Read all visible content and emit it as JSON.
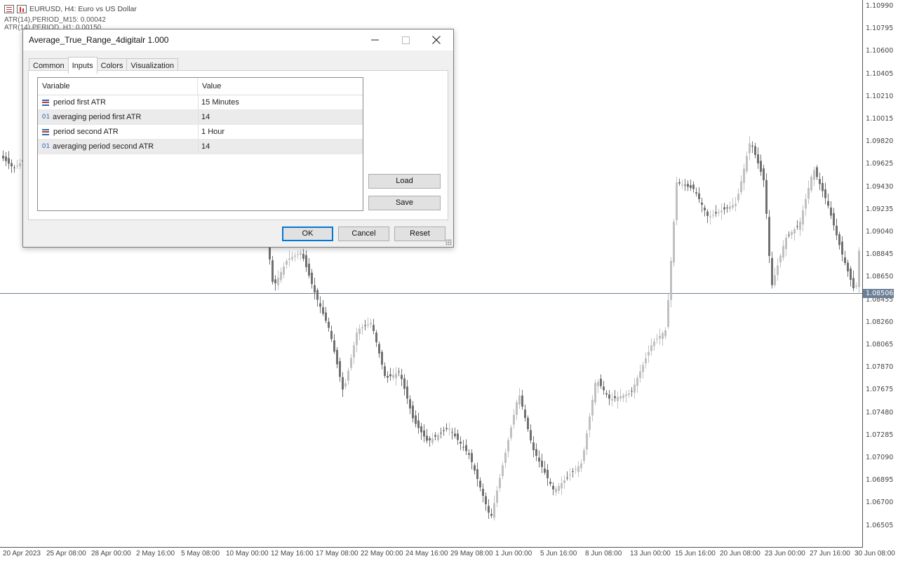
{
  "chart": {
    "symbol_title": "EURUSD, H4:  Euro vs US Dollar",
    "indicator_lines": [
      "ATR(14),PERIOD_M15: 0.00042",
      "ATR(14),PERIOD_H1: 0.00150"
    ],
    "price_labels": [
      "1.10990",
      "1.10795",
      "1.10600",
      "1.10405",
      "1.10210",
      "1.10015",
      "1.09820",
      "1.09625",
      "1.09430",
      "1.09235",
      "1.09040",
      "1.08845",
      "1.08650",
      "1.08455",
      "1.08260",
      "1.08065",
      "1.07870",
      "1.07675",
      "1.07480",
      "1.07285",
      "1.07090",
      "1.06895",
      "1.06700",
      "1.06505"
    ],
    "current_price": "1.08506",
    "date_labels": [
      "20 Apr 2023",
      "25 Apr 08:00",
      "28 Apr 00:00",
      "2 May 16:00",
      "5 May 08:00",
      "10 May 00:00",
      "12 May 16:00",
      "17 May 08:00",
      "22 May 00:00",
      "24 May 16:00",
      "29 May 08:00",
      "1 Jun 00:00",
      "5 Jun 16:00",
      "8 Jun 08:00",
      "13 Jun 00:00",
      "15 Jun 16:00",
      "20 Jun 08:00",
      "23 Jun 00:00",
      "27 Jun 16:00",
      "30 Jun 08:00"
    ],
    "colors": {
      "bull": "#c0c0c0",
      "bear": "#707070",
      "price_line": "#6b7f96"
    }
  },
  "dialog": {
    "title": "Average_True_Range_4digitalr 1.000",
    "window_controls": {
      "minimize": "—",
      "maximize": "☐",
      "close": "✕"
    },
    "tabs": [
      {
        "label": "Common",
        "active": false
      },
      {
        "label": "Inputs",
        "active": true
      },
      {
        "label": "Colors",
        "active": false
      },
      {
        "label": "Visualization",
        "active": false
      }
    ],
    "table": {
      "headers": {
        "variable": "Variable",
        "value": "Value"
      },
      "rows": [
        {
          "icon": "enum-icon",
          "variable": "period first ATR",
          "value": "15 Minutes"
        },
        {
          "icon": "integer-icon",
          "icon_text": "01",
          "variable": "averaging period first ATR",
          "value": "14"
        },
        {
          "icon": "enum-icon",
          "variable": "period second ATR",
          "value": "1 Hour"
        },
        {
          "icon": "integer-icon",
          "icon_text": "01",
          "variable": "averaging period second ATR",
          "value": "14"
        }
      ]
    },
    "buttons": {
      "load": "Load",
      "save": "Save",
      "ok": "OK",
      "cancel": "Cancel",
      "reset": "Reset"
    }
  }
}
